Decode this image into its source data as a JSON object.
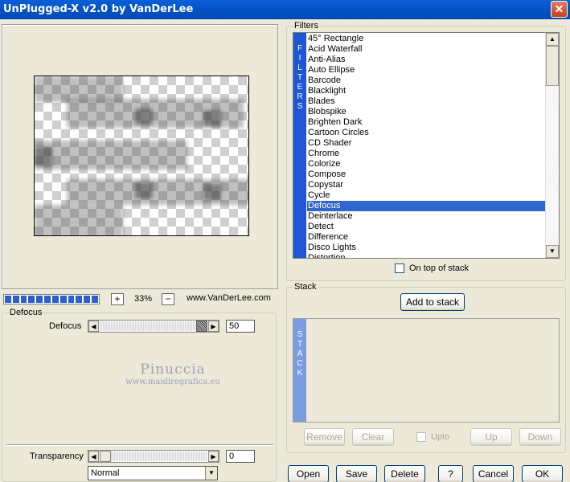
{
  "window": {
    "title": "UnPlugged-X v2.0 by VanDerLee",
    "close_glyph": "✕"
  },
  "preview": {
    "zoom_minus": "−",
    "zoom_plus": "+",
    "zoom_level": "33%",
    "website": "www.VanDerLee.com",
    "progress_fraction": 1.0
  },
  "params": {
    "group_label": "Defocus",
    "defocus_label": "Defocus",
    "defocus_value": "50",
    "defocus_fraction": 1.0,
    "transparency_label": "Transparency",
    "transparency_value": "0",
    "transparency_fraction": 0.0,
    "blend_mode": "Normal"
  },
  "watermark": {
    "line1": "Pinuccia",
    "line2": "www.maidiregrafica.eu"
  },
  "filters": {
    "group_label": "Filters",
    "side_tag": [
      "F",
      "I",
      "L",
      "T",
      "E",
      "R",
      "S"
    ],
    "items": [
      "45° Rectangle",
      "Acid Waterfall",
      "Anti-Alias",
      "Auto Ellipse",
      "Barcode",
      "Blacklight",
      "Blades",
      "Blobspike",
      "Brighten Dark",
      "Cartoon Circles",
      "CD Shader",
      "Chrome",
      "Colorize",
      "Compose",
      "Copystar",
      "Cycle",
      "Defocus",
      "Deinterlace",
      "Detect",
      "Difference",
      "Disco Lights",
      "Distortion"
    ],
    "selected": "Defocus",
    "on_top_label": "On top of stack"
  },
  "stack": {
    "group_label": "Stack",
    "add_label": "Add to stack",
    "side_tag": [
      "S",
      "T",
      "A",
      "C",
      "K"
    ],
    "remove_label": "Remove",
    "clear_label": "Clear",
    "upto_label": "Upto",
    "up_label": "Up",
    "down_label": "Down"
  },
  "footer": {
    "open": "Open",
    "save": "Save",
    "delete": "Delete",
    "help": "?",
    "cancel": "Cancel",
    "ok": "OK"
  },
  "icons": {
    "left_arrow": "◀",
    "right_arrow": "▶",
    "up_arrow": "▲",
    "down_arrow": "▼"
  },
  "colors": {
    "title_bar": "#0453c8",
    "selection": "#3166cc",
    "filters_tag": "#1f56d6",
    "stack_tag": "#7b9de0"
  }
}
